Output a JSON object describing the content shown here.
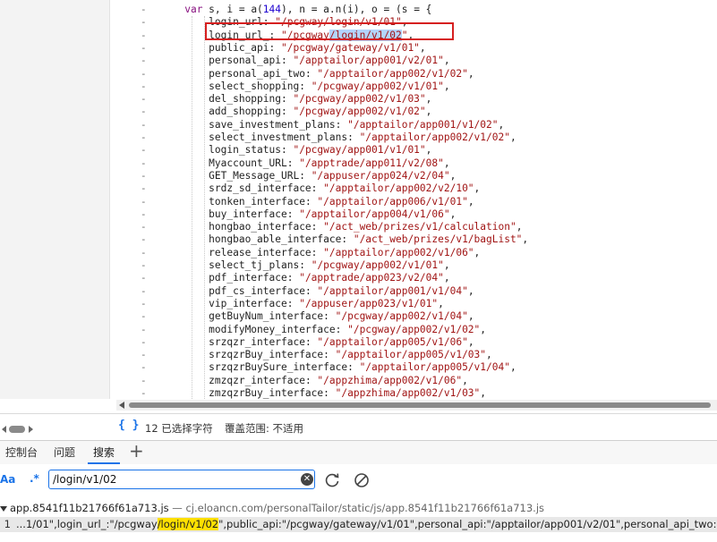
{
  "editor": {
    "first_line": {
      "kw1": "var",
      "mid1": " s, i = a(",
      "num1": "144",
      "mid2": "), n = a.n(i), o = (s = {"
    },
    "gutter_marker": "-",
    "lines": [
      {
        "prop": "login_url",
        "value": "\"/pcgway/login/v1/01\""
      },
      {
        "prop": "login_url_",
        "value_pre": "\"/pcgway",
        "value_sel": "/login/v1/02",
        "value_post": "\""
      },
      {
        "prop": "public_api",
        "value": "\"/pcgway/gateway/v1/01\""
      },
      {
        "prop": "personal_api",
        "value": "\"/apptailor/app001/v2/01\""
      },
      {
        "prop": "personal_api_two",
        "value": "\"/apptailor/app002/v1/02\""
      },
      {
        "prop": "select_shopping",
        "value": "\"/pcgway/app002/v1/01\""
      },
      {
        "prop": "del_shopping",
        "value": "\"/pcgway/app002/v1/03\""
      },
      {
        "prop": "add_shopping",
        "value": "\"/pcgway/app002/v1/02\""
      },
      {
        "prop": "save_investment_plans",
        "value": "\"/apptailor/app001/v1/02\""
      },
      {
        "prop": "select_investment_plans",
        "value": "\"/apptailor/app002/v1/02\""
      },
      {
        "prop": "login_status",
        "value": "\"/pcgway/app001/v1/01\""
      },
      {
        "prop": "Myaccount_URL",
        "value": "\"/apptrade/app011/v2/08\""
      },
      {
        "prop": "GET_Message_URL",
        "value": "\"/appuser/app024/v2/04\""
      },
      {
        "prop": "srdz_sd_interface",
        "value": "\"/apptailor/app002/v2/10\""
      },
      {
        "prop": "tonken_interface",
        "value": "\"/apptailor/app006/v1/01\""
      },
      {
        "prop": "buy_interface",
        "value": "\"/apptailor/app004/v1/06\""
      },
      {
        "prop": "hongbao_interface",
        "value": "\"/act_web/prizes/v1/calculation\""
      },
      {
        "prop": "hongbao_able_interface",
        "value": "\"/act_web/prizes/v1/bagList\""
      },
      {
        "prop": "release_interface",
        "value": "\"/apptailor/app002/v1/06\""
      },
      {
        "prop": "select_tj_plans",
        "value": "\"/pcgway/app002/v1/01\""
      },
      {
        "prop": "pdf_interface",
        "value": "\"/apptrade/app023/v2/04\""
      },
      {
        "prop": "pdf_cs_interface",
        "value": "\"/apptailor/app001/v1/04\""
      },
      {
        "prop": "vip_interface",
        "value": "\"/appuser/app023/v1/01\""
      },
      {
        "prop": "getBuyNum_interface",
        "value": "\"/pcgway/app002/v1/04\""
      },
      {
        "prop": "modifyMoney_interface",
        "value": "\"/pcgway/app002/v1/02\""
      },
      {
        "prop": "srzqzr_interface",
        "value": "\"/apptailor/app005/v1/06\""
      },
      {
        "prop": "srzqzrBuy_interface",
        "value": "\"/apptailor/app005/v1/03\""
      },
      {
        "prop": "srzqzrBuySure_interface",
        "value": "\"/apptailor/app005/v1/04\""
      },
      {
        "prop": "zmzqzr_interface",
        "value": "\"/appzhima/app002/v1/06\""
      },
      {
        "prop": "zmzqzrBuy_interface",
        "value": "\"/appzhima/app002/v1/03\""
      }
    ]
  },
  "statusbar": {
    "format_icon": "{ }",
    "selection_text": "12 已选择字符",
    "coverage_text": "覆盖范围: 不适用"
  },
  "tabs": [
    {
      "label": "控制台",
      "active": false
    },
    {
      "label": "问题",
      "active": false
    },
    {
      "label": "搜索",
      "active": true
    }
  ],
  "search": {
    "match_case_label": "Aa",
    "regex_label": ".*",
    "query": "/login/v1/02",
    "clear_glyph": "✕"
  },
  "results": {
    "file_name": "app.8541f11b21766f61a713.js",
    "file_sep": " — ",
    "file_path": "cj.eloancn.com/personalTailor/static/js/app.8541f11b21766f61a713.js",
    "line_number": "1",
    "snippet_pre": "...1/01\",login_url_:\"/pcgway",
    "snippet_match": "/login/v1/02",
    "snippet_post": "\",public_api:\"/pcgway/gateway/v1/01\",personal_api:\"/apptailor/app001/v2/01\",personal_api_two:\"/apptailor/app002/v1/02\""
  }
}
